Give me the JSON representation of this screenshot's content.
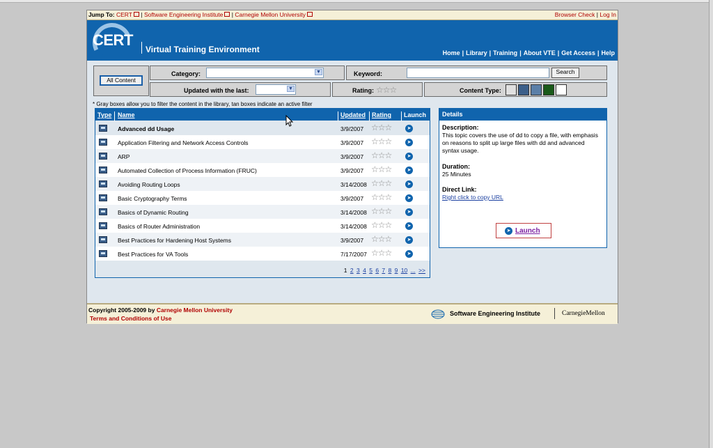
{
  "jumpbar": {
    "label": "Jump To:",
    "links": [
      "CERT",
      "Software Engineering Institute",
      "Carnegie Mellon University"
    ],
    "right_links": [
      "Browser Check",
      "Log In"
    ],
    "sep": "|"
  },
  "header": {
    "logo": "CERT",
    "title": "Virtual Training Environment",
    "nav": [
      "Home",
      "Library",
      "Training",
      "About VTE",
      "Get Access",
      "Help"
    ]
  },
  "filters": {
    "all_content": "All Content",
    "category_label": "Category:",
    "keyword_label": "Keyword:",
    "search_button": "Search",
    "updated_label": "Updated with the last:",
    "rating_label": "Rating:",
    "content_type_label": "Content Type:",
    "stars": "☆☆☆",
    "note": "* Gray boxes allow you to filter the content in the library, tan boxes indicate an active filter"
  },
  "table": {
    "headers": {
      "type": "Type",
      "name": "Name",
      "updated": "Updated",
      "rating": "Rating",
      "launch": "Launch"
    },
    "rows": [
      {
        "name": "Advanced dd Usage",
        "updated": "3/9/2007",
        "rating": "☆☆☆",
        "selected": true
      },
      {
        "name": "Application Filtering and Network Access Controls",
        "updated": "3/9/2007",
        "rating": "☆☆☆"
      },
      {
        "name": "ARP",
        "updated": "3/9/2007",
        "rating": "☆☆☆"
      },
      {
        "name": "Automated Collection of Process Information (FRUC)",
        "updated": "3/9/2007",
        "rating": "☆☆☆"
      },
      {
        "name": "Avoiding Routing Loops",
        "updated": "3/14/2008",
        "rating": "☆☆☆"
      },
      {
        "name": "Basic Cryptography Terms",
        "updated": "3/9/2007",
        "rating": "☆☆☆"
      },
      {
        "name": "Basics of Dynamic Routing",
        "updated": "3/14/2008",
        "rating": "☆☆☆"
      },
      {
        "name": "Basics of Router Administration",
        "updated": "3/14/2008",
        "rating": "☆☆☆"
      },
      {
        "name": "Best Practices for Hardening Host Systems",
        "updated": "3/9/2007",
        "rating": "☆☆☆"
      },
      {
        "name": "Best Practices for VA Tools",
        "updated": "7/17/2007",
        "rating": "☆☆☆"
      }
    ],
    "pager": {
      "current": "1",
      "pages": [
        "2",
        "3",
        "4",
        "5",
        "6",
        "7",
        "8",
        "9",
        "10",
        "...",
        ">>"
      ]
    }
  },
  "details": {
    "title": "Details",
    "description_label": "Description:",
    "description": "This topic covers the use of dd to copy a file, with emphasis on reasons to split up large files with dd and advanced syntax usage.",
    "duration_label": "Duration:",
    "duration": "25 Minutes",
    "direct_link_label": "Direct Link:",
    "direct_link": "Right click to copy URL",
    "launch": "Launch"
  },
  "footer": {
    "copyright": "Copyright 2005-2009 by",
    "cmu": "Carnegie Mellon University",
    "terms": "Terms and Conditions of Use",
    "sei": "Software Engineering Institute",
    "cmu_logo": "CarnegieMellon"
  },
  "colors": {
    "brand_blue": "#1064ad",
    "tan": "#f5f0d8",
    "link_red": "#b00000"
  }
}
